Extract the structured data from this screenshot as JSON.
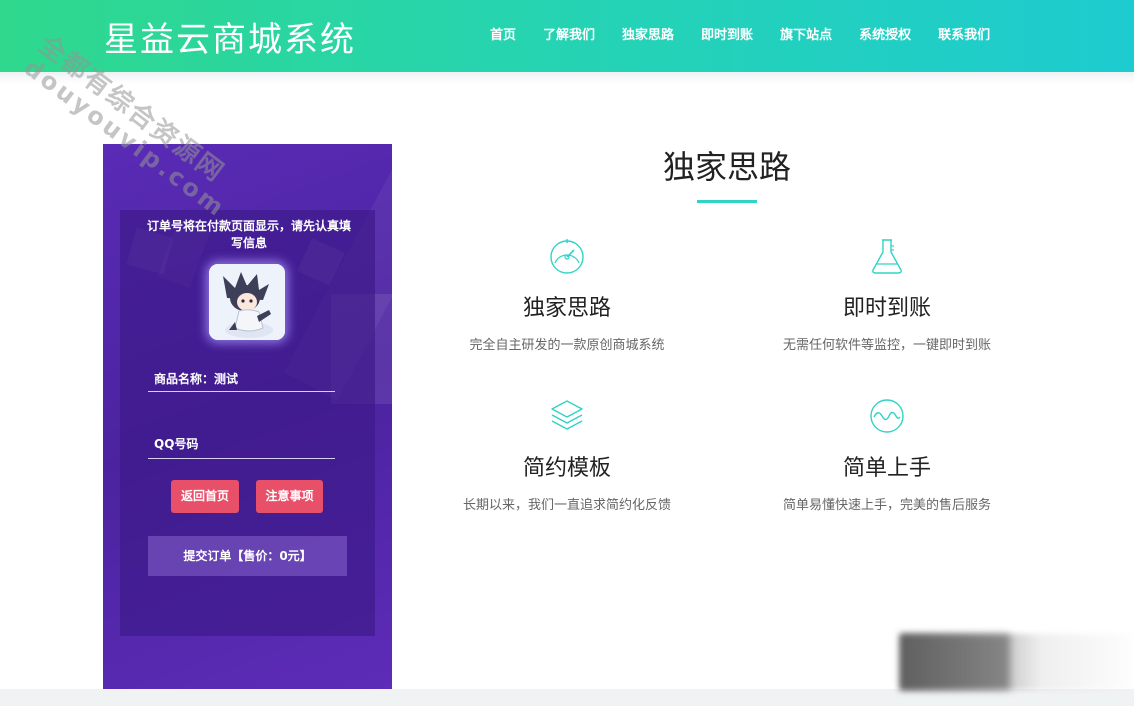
{
  "header": {
    "logo": "星益云商城系统",
    "nav": [
      "首页",
      "了解我们",
      "独家思路",
      "即时到账",
      "旗下站点",
      "系统授权",
      "联系我们"
    ]
  },
  "watermark": {
    "line1": "全都有综合资源网",
    "line2": "douyouvip.com"
  },
  "order_form": {
    "notice": "订单号将在付款页面显示，请先认真填写信息",
    "product_label": "商品名称：测试",
    "qq_placeholder": "QQ号码",
    "back_button": "返回首页",
    "notes_button": "注意事项",
    "submit_button": "提交订单【售价：0元】"
  },
  "section": {
    "title": "独家思路",
    "features": [
      {
        "name": "独家思路",
        "desc": "完全自主研发的一款原创商城系统",
        "icon": "speedometer-icon"
      },
      {
        "name": "即时到账",
        "desc": "无需任何软件等监控，一键即时到账",
        "icon": "flask-icon"
      },
      {
        "name": "简约模板",
        "desc": "长期以来，我们一直追求简约化反馈",
        "icon": "layers-icon"
      },
      {
        "name": "简单上手",
        "desc": "简单易懂快速上手，完美的售后服务",
        "icon": "wave-icon"
      }
    ]
  },
  "colors": {
    "accent": "#31d3c4",
    "header_start": "#2fd88c",
    "header_end": "#1ecbd0",
    "panel": "#5a2bb6",
    "button_red": "#e8506a"
  }
}
